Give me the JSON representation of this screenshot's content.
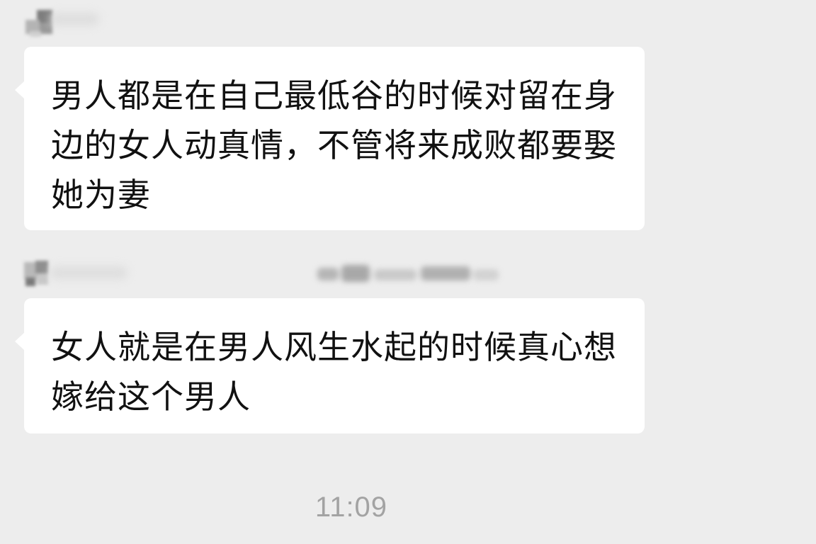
{
  "messages": [
    {
      "text": "男人都是在自己最低谷的时候对留在身边的女人动真情，不管将来成败都要娶她为妻"
    },
    {
      "text": "女人就是在男人风生水起的时候真心想嫁给这个男人"
    }
  ],
  "timestamp": "11:09",
  "colors": {
    "background": "#ededed",
    "bubble": "#ffffff",
    "text": "#111111",
    "timestamp": "#a3a3a3"
  }
}
